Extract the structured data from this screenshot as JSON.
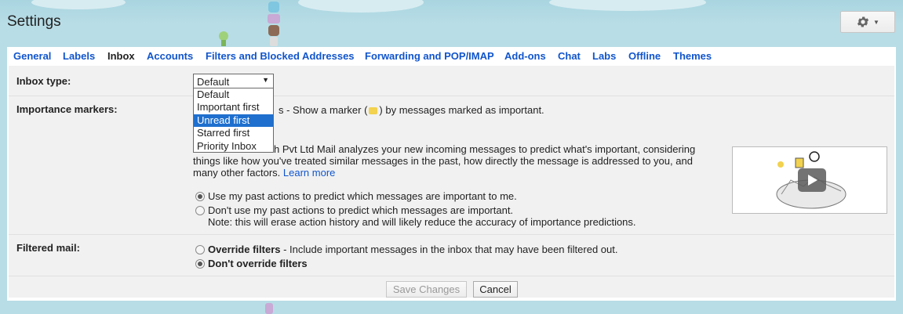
{
  "header": {
    "title": "Settings"
  },
  "tabs": [
    {
      "label": "General"
    },
    {
      "label": "Labels"
    },
    {
      "label": "Inbox"
    },
    {
      "label": "Accounts"
    },
    {
      "label": "Filters and Blocked Addresses"
    },
    {
      "label": "Forwarding and POP/IMAP"
    },
    {
      "label": "Add-ons"
    },
    {
      "label": "Chat"
    },
    {
      "label": "Labs"
    },
    {
      "label": "Offline"
    },
    {
      "label": "Themes"
    }
  ],
  "inbox_type": {
    "label": "Inbox type:",
    "selected": "Default",
    "options": [
      "Default",
      "Important first",
      "Unread first",
      "Starred first",
      "Priority Inbox"
    ],
    "highlighted": "Unread first"
  },
  "importance": {
    "label": "Importance markers:",
    "show_line_suffix": "s - Show a marker (",
    "show_line_end": ") by messages marked as important.",
    "desc_line1": "h Pvt Ltd Mail analyzes your new incoming messages to predict what's important, considering",
    "desc_line2": "things like how you've treated similar messages in the past, how directly the message is addressed to you, and",
    "desc_line3": "many other factors.",
    "learn_more": "Learn more",
    "option_use": "Use my past actions to predict which messages are important to me.",
    "option_dont": "Don't use my past actions to predict which messages are important.",
    "note": "Note: this will erase action history and will likely reduce the accuracy of importance predictions."
  },
  "filtered": {
    "label": "Filtered mail:",
    "override_bold": "Override filters",
    "override_rest": " - Include important messages in the inbox that may have been filtered out.",
    "dont_override": "Don't override filters"
  },
  "buttons": {
    "save": "Save Changes",
    "cancel": "Cancel"
  },
  "icons": {
    "gear": "gear-icon",
    "dropdown": "dropdown-caret-icon",
    "play": "play-icon"
  }
}
